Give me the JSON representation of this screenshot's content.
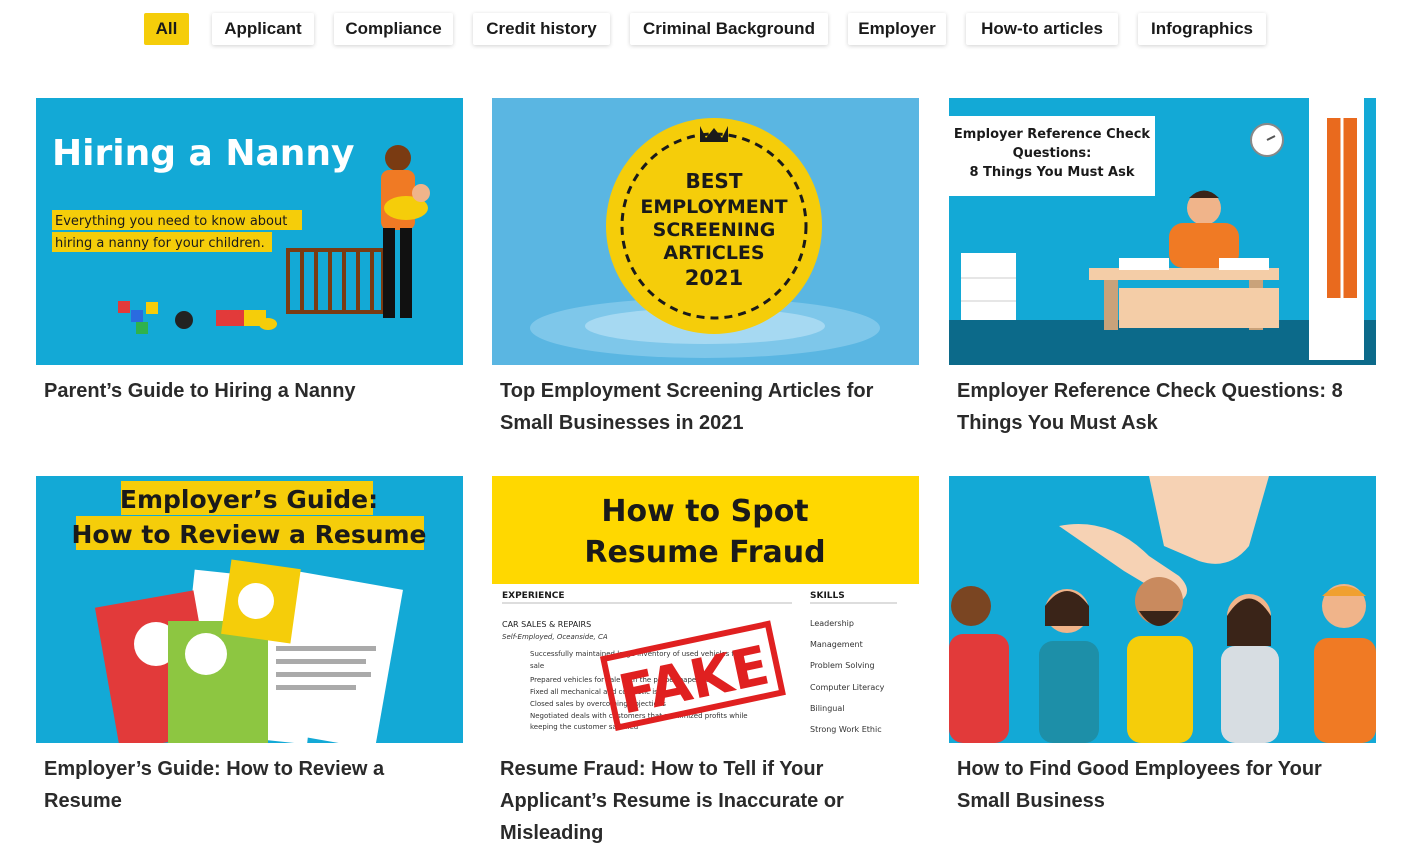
{
  "filters": [
    "All",
    "Applicant",
    "Compliance",
    "Credit history",
    "Criminal Background",
    "Employer",
    "How-to articles",
    "Infographics"
  ],
  "colors": {
    "accent": "#f5cd0a",
    "thumb_blue": "#13a9d6",
    "dark_text": "#2a2a2a"
  },
  "cards": [
    {
      "title": "Parent’s Guide to Hiring a Nanny",
      "thumb": {
        "heading": "Hiring a Nanny",
        "sub1": "Everything you need to know about",
        "sub2": "hiring a nanny for your children."
      }
    },
    {
      "title": "Top Employment Screening Articles for Small Businesses in 2021",
      "thumb": {
        "l1": "BEST",
        "l2": "EMPLOYMENT",
        "l3": "SCREENING",
        "l4": "ARTICLES",
        "l5": "2021"
      }
    },
    {
      "title": "Employer Reference Check Questions: 8 Things You Must Ask",
      "thumb": {
        "l1": "Employer Reference Check",
        "l2": "Questions:",
        "l3": "8 Things You Must Ask"
      }
    },
    {
      "title": "Employer’s Guide: How to Review a Resume",
      "thumb": {
        "l1": "Employer’s Guide:",
        "l2": "How to Review a Resume"
      }
    },
    {
      "title": "Resume Fraud: How to Tell if Your Applicant’s Resume is Inaccurate or Misleading",
      "thumb": {
        "l1": "How to Spot",
        "l2": "Resume Fraud",
        "experience": "EXPERIENCE",
        "skills": "SKILLS",
        "job": "CAR SALES & REPAIRS",
        "job_sub": "Self-Employed, Oceanside, CA",
        "bullets": [
          "Successfully maintained large inventory of used vehicles for",
          "sale",
          "Prepared vehicles for sale with the proper paperwork",
          "Fixed all mechanical and cosmetic issues",
          "Closed sales by overcoming objections",
          "Negotiated deals with customers that maximized profits while",
          "keeping the customer satisfied"
        ],
        "skill_list": [
          "Leadership",
          "Management",
          "Problem Solving",
          "Computer Literacy",
          "Bilingual",
          "Strong Work Ethic"
        ],
        "stamp": "FAKE"
      }
    },
    {
      "title": "How to Find Good Employees for Your Small Business",
      "thumb": {}
    }
  ]
}
